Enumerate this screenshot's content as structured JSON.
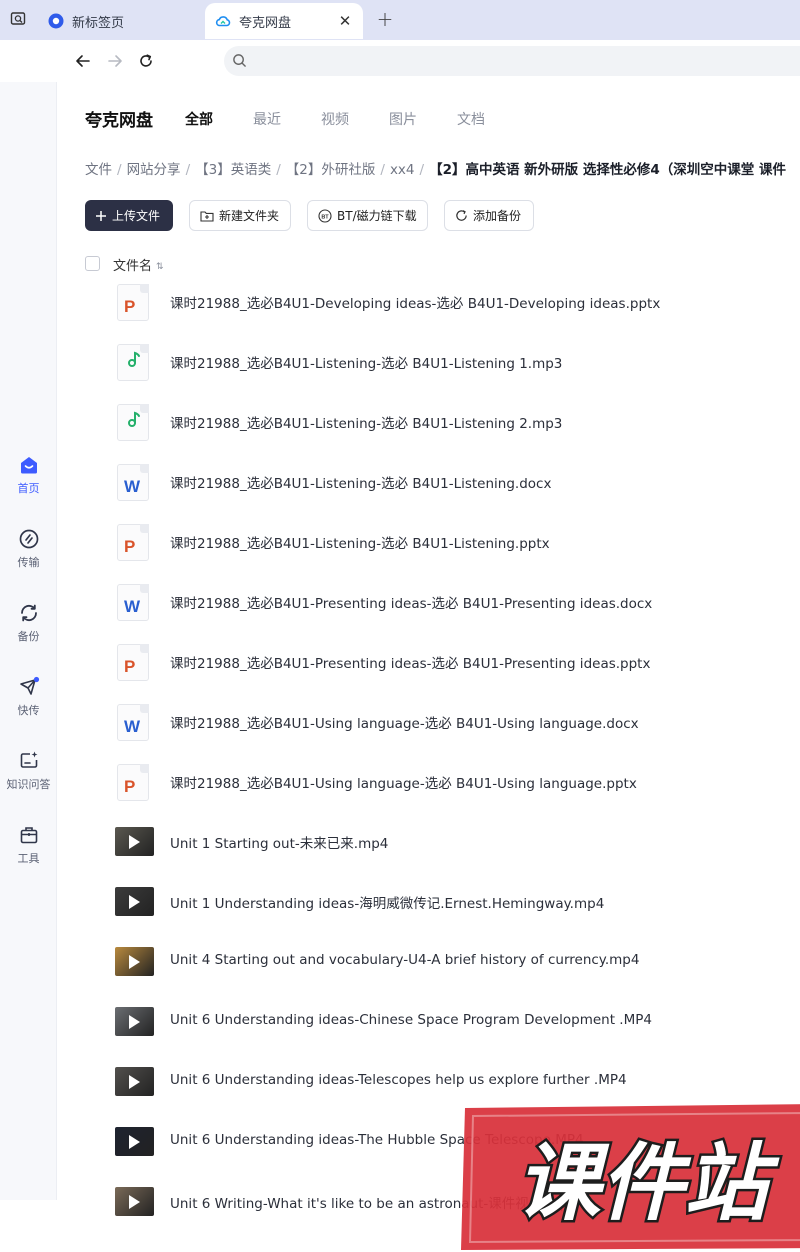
{
  "browser": {
    "tabs": [
      {
        "title": "新标签页",
        "active": false
      },
      {
        "title": "夸克网盘",
        "active": true
      }
    ],
    "new_tab_symbol": "+",
    "close_symbol": "✕"
  },
  "rail": {
    "items": [
      {
        "label": "首页",
        "icon": "home-icon",
        "active": true
      },
      {
        "label": "传输",
        "icon": "transfer-icon",
        "active": false
      },
      {
        "label": "备份",
        "icon": "backup-icon",
        "active": false
      },
      {
        "label": "快传",
        "icon": "quick-send-icon",
        "active": false
      },
      {
        "label": "知识问答",
        "icon": "qa-icon",
        "active": false
      },
      {
        "label": "工具",
        "icon": "toolbox-icon",
        "active": false
      }
    ]
  },
  "header": {
    "app_title": "夸克网盘",
    "filter_tabs": [
      "全部",
      "最近",
      "视频",
      "图片",
      "文档"
    ],
    "active_filter": "全部"
  },
  "breadcrumb": {
    "items": [
      "文件",
      "网站分享",
      "【3】英语类",
      "【2】外研社版",
      "xx4",
      "【2】高中英语 新外研版 选择性必修4（深圳空中课堂 课件"
    ],
    "separator": "/"
  },
  "actions": {
    "upload": "上传文件",
    "new_folder": "新建文件夹",
    "bt_download": "BT/磁力链下载",
    "add_backup": "添加备份"
  },
  "list": {
    "column_name": "文件名",
    "files": [
      {
        "name": "课时21988_选必B4U1-Developing ideas-选必 B4U1-Developing ideas.pptx",
        "kind": "pptx"
      },
      {
        "name": "课时21988_选必B4U1-Listening-选必 B4U1-Listening 1.mp3",
        "kind": "mp3"
      },
      {
        "name": "课时21988_选必B4U1-Listening-选必 B4U1-Listening 2.mp3",
        "kind": "mp3"
      },
      {
        "name": "课时21988_选必B4U1-Listening-选必 B4U1-Listening.docx",
        "kind": "docx"
      },
      {
        "name": "课时21988_选必B4U1-Listening-选必 B4U1-Listening.pptx",
        "kind": "pptx"
      },
      {
        "name": "课时21988_选必B4U1-Presenting ideas-选必 B4U1-Presenting ideas.docx",
        "kind": "docx"
      },
      {
        "name": "课时21988_选必B4U1-Presenting ideas-选必 B4U1-Presenting ideas.pptx",
        "kind": "pptx"
      },
      {
        "name": "课时21988_选必B4U1-Using language-选必 B4U1-Using language.docx",
        "kind": "docx"
      },
      {
        "name": "课时21988_选必B4U1-Using language-选必 B4U1-Using language.pptx",
        "kind": "pptx"
      },
      {
        "name": "Unit 1 Starting out-未来已来.mp4",
        "kind": "video",
        "thumb_color": "#5a5850"
      },
      {
        "name": "Unit 1 Understanding ideas-海明威微传记.Ernest.Hemingway.mp4",
        "kind": "video",
        "thumb_color": "#3c3c3c"
      },
      {
        "name": "Unit 4 Starting out and vocabulary-U4-A brief history of currency.mp4",
        "kind": "video",
        "thumb_color": "#b98a3e"
      },
      {
        "name": "Unit 6 Understanding ideas-Chinese Space Program Development .MP4",
        "kind": "video",
        "thumb_color": "#6b6e72"
      },
      {
        "name": "Unit 6 Understanding ideas-Telescopes help us explore further .MP4",
        "kind": "video",
        "thumb_color": "#52504d"
      },
      {
        "name": "Unit 6 Understanding ideas-The Hubble Space Telescope.MP4",
        "kind": "video",
        "thumb_color": "#1e2330"
      },
      {
        "name": "Unit 6 Writing-What it's like to be an astronaut-课件视频.mp4",
        "kind": "video",
        "thumb_color": "#7a6a58"
      }
    ]
  },
  "watermark": {
    "text": "课件站"
  },
  "colors": {
    "accent": "#3d5bff",
    "primary_button": "#2c3045",
    "ppt": "#d9542b",
    "word": "#2a5fd0",
    "audio": "#25b06b",
    "watermark_red": "#d8303a"
  }
}
